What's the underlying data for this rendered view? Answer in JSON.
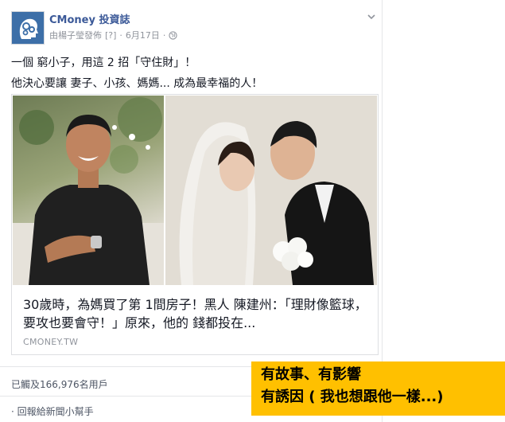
{
  "post": {
    "page_name": "CMoney 投資誌",
    "published_by": "由楊子瑩發佈",
    "help_mark": "[?]",
    "separator": "·",
    "date": "6月17日",
    "separator2": "·",
    "text_line1": "一個 窮小子，用這 2 招「守住財」！",
    "text_line2": "他決心要讓 妻子、小孩、媽媽... 成為最幸福的人！"
  },
  "link": {
    "title": "30歲時，為媽買了第 1間房子！黑人 陳建州：「理財像籃球，要攻也要會守！」原來，他的 錢都投在...",
    "domain": "CMONEY.TW"
  },
  "footer": {
    "reach": "已觸及166,976名用戶",
    "report": "· 回報給新聞小幫手"
  },
  "callout": {
    "line1": "有故事、有影響",
    "line2": "有誘因 ( 我也想跟他一樣...)",
    "color": "#ffc000"
  },
  "icons": [
    "cmoney-logo-icon",
    "globe-icon",
    "chevron-down-icon"
  ]
}
